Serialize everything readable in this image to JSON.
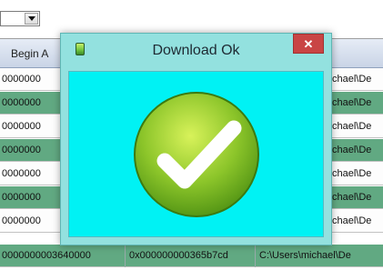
{
  "grid": {
    "header": [
      "Begin A",
      ""
    ],
    "rows": [
      {
        "c1": "0000000",
        "c2": "",
        "c3": "chael\\De",
        "color": "white"
      },
      {
        "c1": "0000000",
        "c2": "",
        "c3": "chael\\De",
        "color": "green"
      },
      {
        "c1": "0000000",
        "c2": "",
        "c3": "chael\\De",
        "color": "white"
      },
      {
        "c1": "0000000",
        "c2": "",
        "c3": "chael\\De",
        "color": "green"
      },
      {
        "c1": "0000000",
        "c2": "",
        "c3": "chael\\De",
        "color": "white"
      },
      {
        "c1": "0000000",
        "c2": "",
        "c3": "chael\\De",
        "color": "green"
      },
      {
        "c1": "0000000",
        "c2": "",
        "c3": "chael\\De",
        "color": "white"
      },
      {
        "c1": "0000000003640000",
        "c2": "0x000000000365b7cd",
        "c3": "C:\\Users\\michael\\De",
        "color": "green"
      }
    ]
  },
  "dialog": {
    "title": "Download Ok",
    "close_label": "✕",
    "icon": "checkmark-success-icon"
  },
  "colors": {
    "row_green": "#61a982",
    "dialog_frame": "#93e1df",
    "dialog_client": "#00f2f4",
    "close_button": "#c94444"
  }
}
